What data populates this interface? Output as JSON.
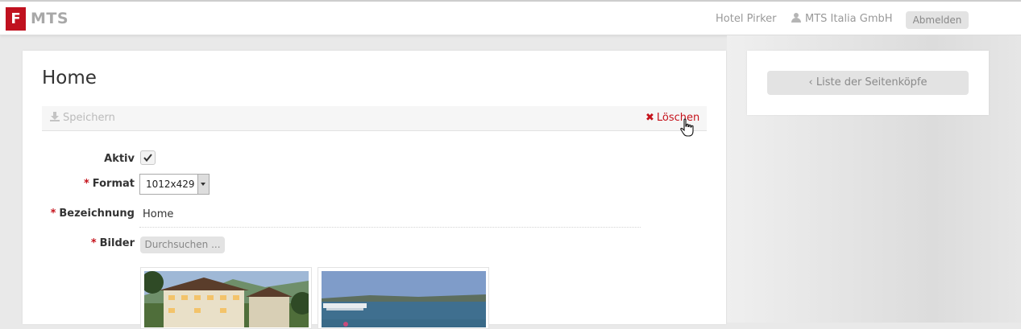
{
  "header": {
    "brand_letter": "F",
    "brand_name": "MTS",
    "hotel_link": "Hotel Pirker",
    "user_link": "MTS Italia GmbH",
    "logout_label": "Abmelden"
  },
  "page": {
    "title": "Home"
  },
  "toolbar": {
    "save_label": "Speichern",
    "delete_label": "Löschen"
  },
  "form": {
    "active_label": "Aktiv",
    "active_checked": true,
    "format_label": "Format",
    "format_value": "1012x429",
    "name_label": "Bezeichnung",
    "name_value": "Home",
    "images_label": "Bilder",
    "browse_label": "Durchsuchen ...",
    "required_marker": "*"
  },
  "images": [
    {
      "name": "hotel-photo"
    },
    {
      "name": "lake-photo"
    }
  ],
  "sidebar": {
    "back_label": "‹ Liste der Seitenköpfe"
  },
  "colors": {
    "brand_red": "#c0111f",
    "delete_red": "#c5121b",
    "button_gray": "#e3e3e3"
  }
}
